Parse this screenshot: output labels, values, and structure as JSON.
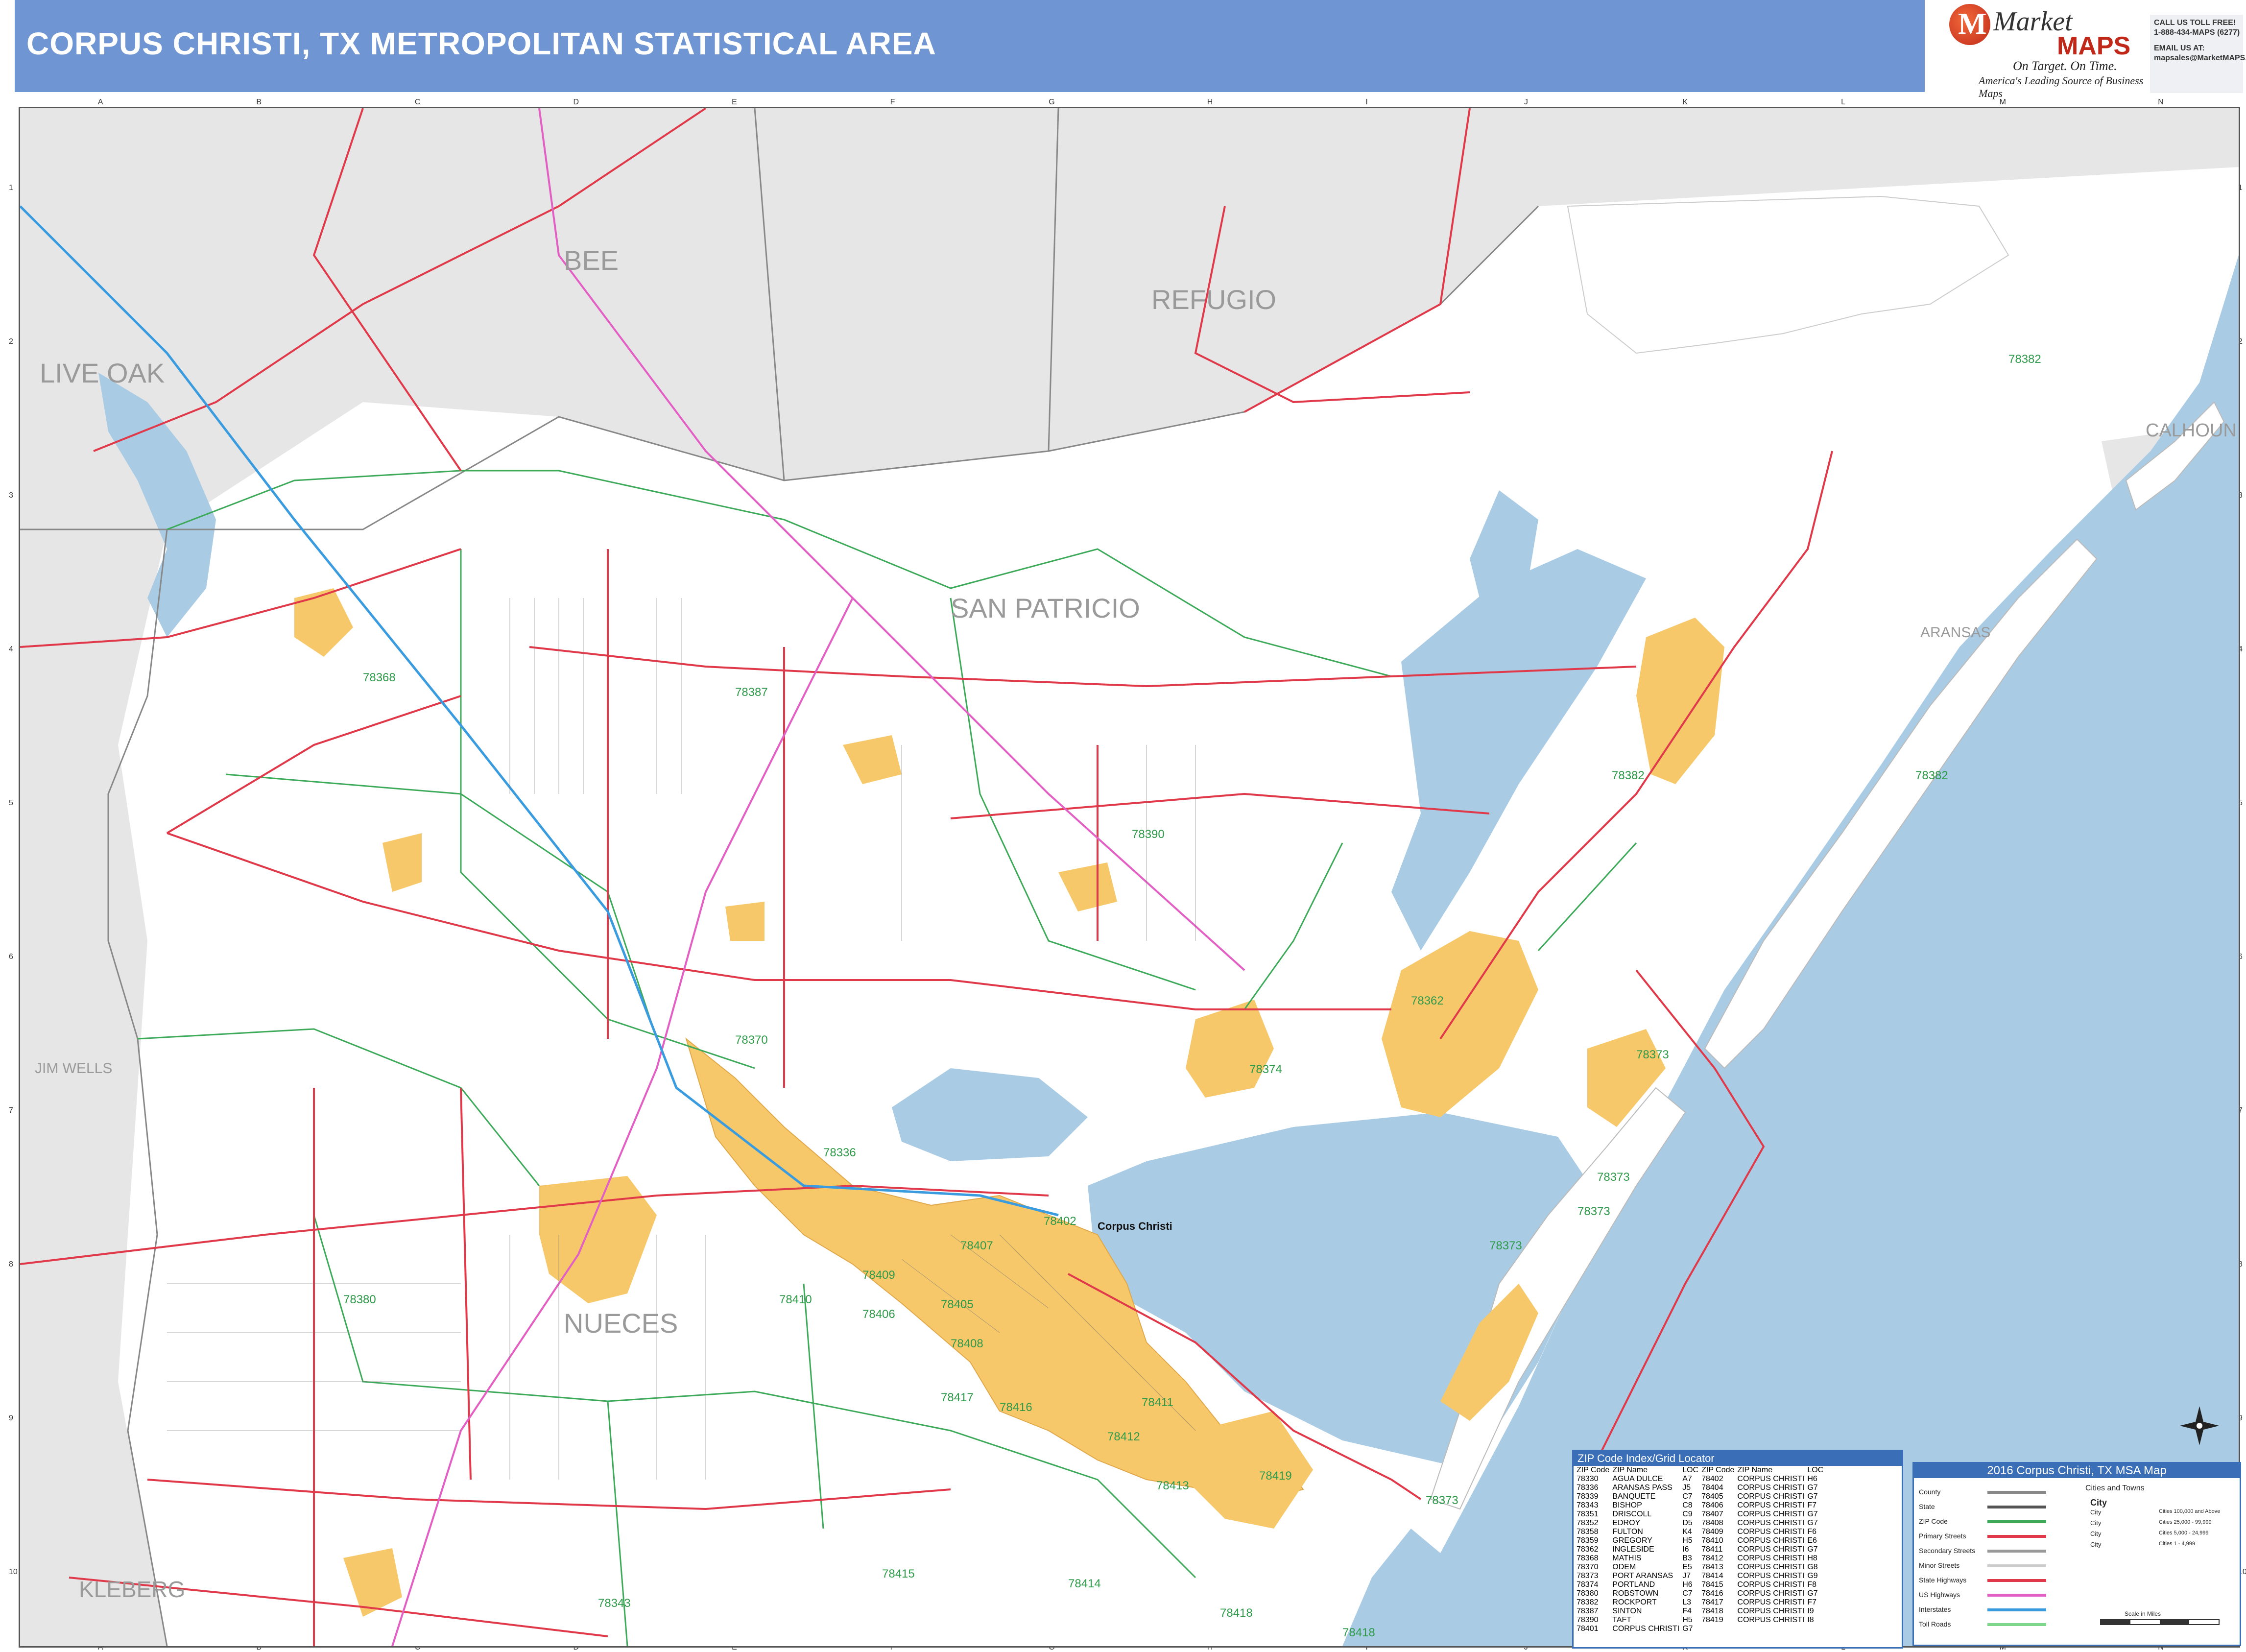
{
  "header": {
    "title": "CORPUS CHRISTI, TX METROPOLITAN STATISTICAL AREA",
    "logo_word1": "Market",
    "logo_word2": "MAPS",
    "logo_letter": "M",
    "tagline": "On Target. On Time.",
    "subtagline": "America's Leading Source of Business Maps",
    "contact_lines": [
      "CALL US TOLL FREE!",
      "1-888-434-MAPS (6277)",
      "EMAIL US AT:",
      "mapsales@MarketMAPS.com"
    ]
  },
  "grid": {
    "columns": [
      "A",
      "B",
      "C",
      "D",
      "E",
      "F",
      "G",
      "H",
      "I",
      "J",
      "K",
      "L",
      "M",
      "N"
    ],
    "rows": [
      "1",
      "2",
      "3",
      "4",
      "5",
      "6",
      "7",
      "8",
      "9",
      "10"
    ]
  },
  "colors": {
    "water": "#a9cbe4",
    "city_fill": "#f7c86a",
    "state_highway": "#e0394a",
    "us_highway": "#e25fc4",
    "interstate": "#3a9cdf",
    "zip_boundary": "#3daa5a",
    "county_line": "#888888",
    "outside_county": "#e6e6e6",
    "header_bg": "#6f96d2"
  },
  "map": {
    "county_labels": [
      "BEE",
      "REFUGIO",
      "LIVE OAK",
      "SAN PATRICIO",
      "CALHOUN",
      "ARANSAS",
      "JIM WELLS",
      "NUECES",
      "KLEBERG"
    ],
    "city_labels": [
      "Corpus Christi"
    ],
    "zip_labels": [
      "78368",
      "78387",
      "78382",
      "78382",
      "78382",
      "78390",
      "78370",
      "78374",
      "78336",
      "78362",
      "78373",
      "78373",
      "78373",
      "78373",
      "78373",
      "78402",
      "78407",
      "78410",
      "78409",
      "78406",
      "78405",
      "78408",
      "78380",
      "78417",
      "78416",
      "78411",
      "78412",
      "78413",
      "78419",
      "78343",
      "78415",
      "78414",
      "78418",
      "78418"
    ]
  },
  "zip_index": {
    "title": "ZIP Code Index/Grid Locator",
    "headers": [
      "ZIP Code",
      "ZIP Name",
      "LOC",
      "ZIP Code",
      "ZIP Name",
      "LOC"
    ],
    "rows": [
      [
        "78330",
        "AGUA DULCE",
        "A7",
        "78402",
        "CORPUS CHRISTI",
        "H6"
      ],
      [
        "78336",
        "ARANSAS PASS",
        "J5",
        "78404",
        "CORPUS CHRISTI",
        "G7"
      ],
      [
        "78339",
        "BANQUETE",
        "C7",
        "78405",
        "CORPUS CHRISTI",
        "G7"
      ],
      [
        "78343",
        "BISHOP",
        "C8",
        "78406",
        "CORPUS CHRISTI",
        "F7"
      ],
      [
        "78351",
        "DRISCOLL",
        "C9",
        "78407",
        "CORPUS CHRISTI",
        "G7"
      ],
      [
        "78352",
        "EDROY",
        "D5",
        "78408",
        "CORPUS CHRISTI",
        "G7"
      ],
      [
        "78358",
        "FULTON",
        "K4",
        "78409",
        "CORPUS CHRISTI",
        "F6"
      ],
      [
        "78359",
        "GREGORY",
        "H5",
        "78410",
        "CORPUS CHRISTI",
        "E6"
      ],
      [
        "78362",
        "INGLESIDE",
        "I6",
        "78411",
        "CORPUS CHRISTI",
        "G7"
      ],
      [
        "78368",
        "MATHIS",
        "B3",
        "78412",
        "CORPUS CHRISTI",
        "H8"
      ],
      [
        "78370",
        "ODEM",
        "E5",
        "78413",
        "CORPUS CHRISTI",
        "G8"
      ],
      [
        "78373",
        "PORT ARANSAS",
        "J7",
        "78414",
        "CORPUS CHRISTI",
        "G9"
      ],
      [
        "78374",
        "PORTLAND",
        "H6",
        "78415",
        "CORPUS CHRISTI",
        "F8"
      ],
      [
        "78380",
        "ROBSTOWN",
        "C7",
        "78416",
        "CORPUS CHRISTI",
        "G7"
      ],
      [
        "78382",
        "ROCKPORT",
        "L3",
        "78417",
        "CORPUS CHRISTI",
        "F7"
      ],
      [
        "78387",
        "SINTON",
        "F4",
        "78418",
        "CORPUS CHRISTI",
        "I9"
      ],
      [
        "78390",
        "TAFT",
        "H5",
        "78419",
        "CORPUS CHRISTI",
        "I8"
      ],
      [
        "78401",
        "CORPUS CHRISTI",
        "G7",
        "",
        "",
        ""
      ]
    ]
  },
  "legend": {
    "title": "2016 Corpus Christi, TX MSA Map",
    "items": [
      "County",
      "State",
      "ZIP Code",
      "Primary Streets",
      "Secondary Streets",
      "Minor Streets",
      "State Highways",
      "US Highways",
      "Interstates",
      "Toll Roads"
    ],
    "cities_title": "Cities and Towns",
    "city_samples": [
      "City",
      "City",
      "City",
      "City",
      "City"
    ],
    "city_ranges": [
      "Cities 100,000 and Above",
      "Cities 25,000 - 99,999",
      "Cities 5,000 - 24,999",
      "Cities 1 - 4,999"
    ],
    "scale_label": "Scale in Miles"
  }
}
